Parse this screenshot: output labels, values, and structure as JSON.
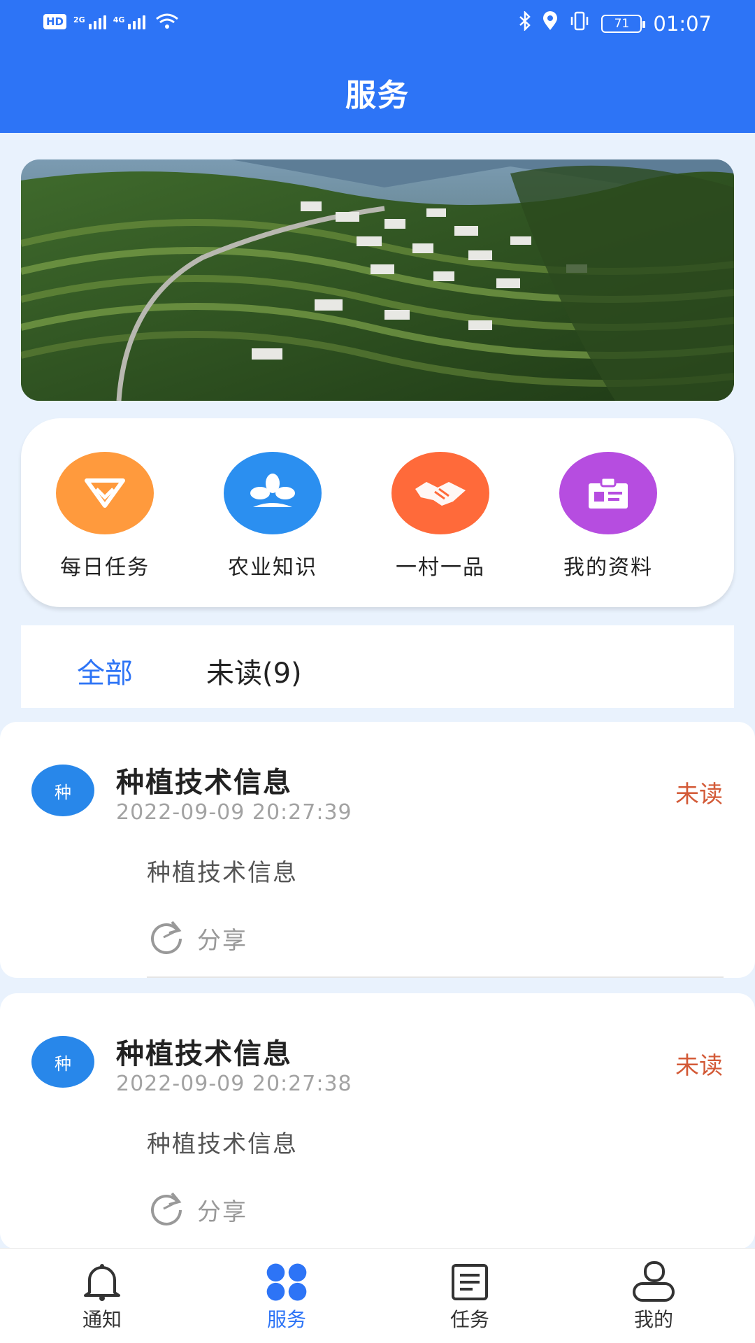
{
  "status_bar": {
    "hd_badge": "HD",
    "sim1_network": "2G",
    "sim2_network": "4G",
    "battery": "71",
    "time": "01:07"
  },
  "header": {
    "title": "服务"
  },
  "quick_menu": [
    {
      "label": "每日任务",
      "icon": "task-diamond-icon",
      "color": "#ff9a3d"
    },
    {
      "label": "农业知识",
      "icon": "plant-leaf-icon",
      "color": "#2b8ff0"
    },
    {
      "label": "一村一品",
      "icon": "handshake-icon",
      "color": "#ff6a3a"
    },
    {
      "label": "我的资料",
      "icon": "id-card-icon",
      "color": "#b64de0"
    }
  ],
  "filter_tabs": {
    "all": "全部",
    "unread": "未读(9)"
  },
  "messages": [
    {
      "avatar": "种",
      "title": "种植技术信息",
      "time": "2022-09-09 20:27:39",
      "status": "未读",
      "body": "种植技术信息",
      "share": "分享"
    },
    {
      "avatar": "种",
      "title": "种植技术信息",
      "time": "2022-09-09 20:27:38",
      "status": "未读",
      "body": "种植技术信息",
      "share": "分享"
    }
  ],
  "bottom_nav": [
    {
      "label": "通知",
      "icon": "bell-icon",
      "active": false
    },
    {
      "label": "服务",
      "icon": "grid-clover-icon",
      "active": true
    },
    {
      "label": "任务",
      "icon": "document-icon",
      "active": false
    },
    {
      "label": "我的",
      "icon": "user-icon",
      "active": false
    }
  ],
  "colors": {
    "primary": "#2d74f6",
    "unread": "#d35a37",
    "background": "#e9f2fd"
  }
}
